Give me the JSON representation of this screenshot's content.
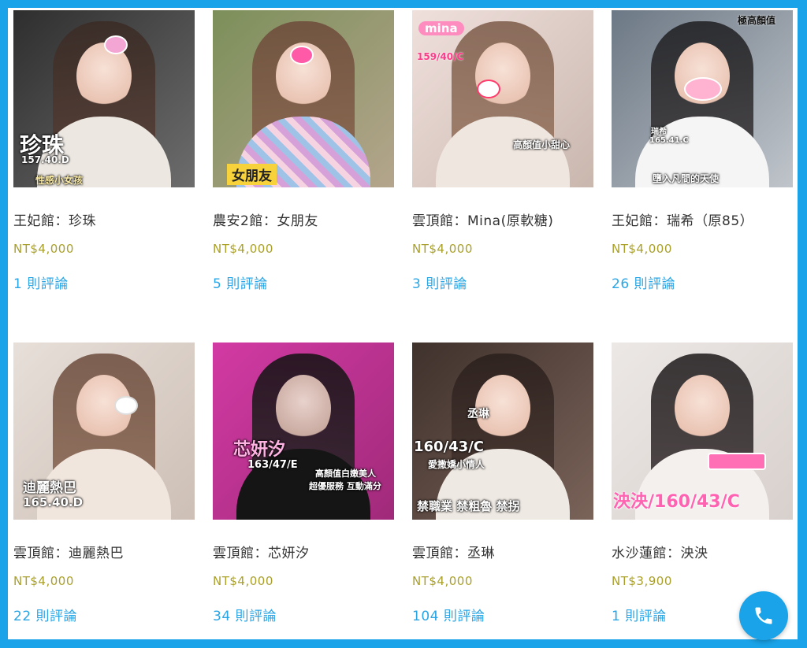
{
  "products": [
    {
      "name": "王妃館：珍珠",
      "price": "NT$4,000",
      "reviews": "1 則評論",
      "overlay": [
        "珍珠",
        "157.40.D",
        "性感小女孩"
      ],
      "colors": {
        "bg": "#3b3b3b",
        "accent": "#e8e4df"
      }
    },
    {
      "name": "農安2館：女朋友",
      "price": "NT$4,000",
      "reviews": "5 則評論",
      "overlay": [
        "女朋友"
      ],
      "colors": {
        "bg": "#6b7f4f",
        "accent": "#c9a6d8"
      }
    },
    {
      "name": "雲頂館：Mina(原軟糖)",
      "price": "NT$4,000",
      "reviews": "3 則評論",
      "overlay": [
        "mina",
        "159/40/C",
        "高顏值小甜心"
      ],
      "colors": {
        "bg": "#d9c7c0",
        "accent": "#a67d6a"
      }
    },
    {
      "name": "王妃館：瑞希（原85）",
      "price": "NT$4,000",
      "reviews": "26 則評論",
      "overlay": [
        "極高顏值",
        "瑞希",
        "165.41.C",
        "墮入凡間的天使"
      ],
      "colors": {
        "bg": "#8e9aa6",
        "accent": "#f2f2f2"
      }
    },
    {
      "name": "雲頂館：迪麗熱巴",
      "price": "NT$4,000",
      "reviews": "22 則評論",
      "overlay": [
        "迪麗熱巴",
        "165.40.D"
      ],
      "colors": {
        "bg": "#d8cfc6",
        "accent": "#f0e4dd"
      }
    },
    {
      "name": "雲頂館：芯妍汐",
      "price": "NT$4,000",
      "reviews": "34 則評論",
      "overlay": [
        "芯妍汐",
        "163/47/E",
        "高顏值白嫩美人",
        "超優服務 互動滿分"
      ],
      "colors": {
        "bg": "#c4379a",
        "accent": "#1a1a1a"
      }
    },
    {
      "name": "雲頂館：丞琳",
      "price": "NT$4,000",
      "reviews": "104 則評論",
      "overlay": [
        "丞琳",
        "160/43/C",
        "愛撒嬌小情人",
        "禁職業 禁粗魯 禁拐"
      ],
      "colors": {
        "bg": "#4a3a36",
        "accent": "#f3eee9"
      }
    },
    {
      "name": "水沙蓮館：泱泱",
      "price": "NT$3,900",
      "reviews": "1 則評論",
      "overlay": [
        "泱泱/160/43/C"
      ],
      "colors": {
        "bg": "#e6e2df",
        "accent": "#2b2b2b"
      }
    }
  ],
  "call_button": {
    "icon": "phone-icon",
    "color": "#1aa3e8"
  }
}
